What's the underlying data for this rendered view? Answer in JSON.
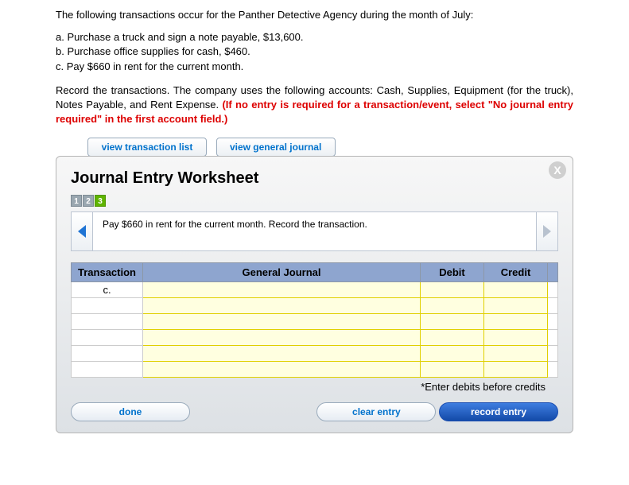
{
  "intro": "The following transactions occur for the Panther Detective Agency during the month of July:",
  "items": {
    "a": "a. Purchase a truck and sign a note payable, $13,600.",
    "b": "b. Purchase office supplies for cash, $460.",
    "c": "c. Pay $660 in rent for the current month."
  },
  "instructions": {
    "lead": "Record the transactions. ",
    "body": "The company uses the following accounts: Cash, Supplies, Equipment (for the truck), Notes Payable, and Rent Expense. ",
    "warn": "(If no entry is required for a transaction/event, select \"No journal entry required\" in the first account field.)"
  },
  "tabs": {
    "list": "view transaction list",
    "journal": "view general journal"
  },
  "panel": {
    "title": "Journal Entry Worksheet",
    "close": "X",
    "steps": [
      "1",
      "2",
      "3"
    ],
    "active_step": 2,
    "prompt": "Pay $660 in rent for the current month. Record the transaction.",
    "headers": {
      "trans": "Transaction",
      "gj": "General Journal",
      "debit": "Debit",
      "credit": "Credit"
    },
    "rows": [
      {
        "label": "c."
      },
      {
        "label": ""
      },
      {
        "label": ""
      },
      {
        "label": ""
      },
      {
        "label": ""
      },
      {
        "label": ""
      }
    ],
    "note": "*Enter debits before credits",
    "buttons": {
      "done": "done",
      "clear": "clear entry",
      "record": "record entry"
    }
  }
}
